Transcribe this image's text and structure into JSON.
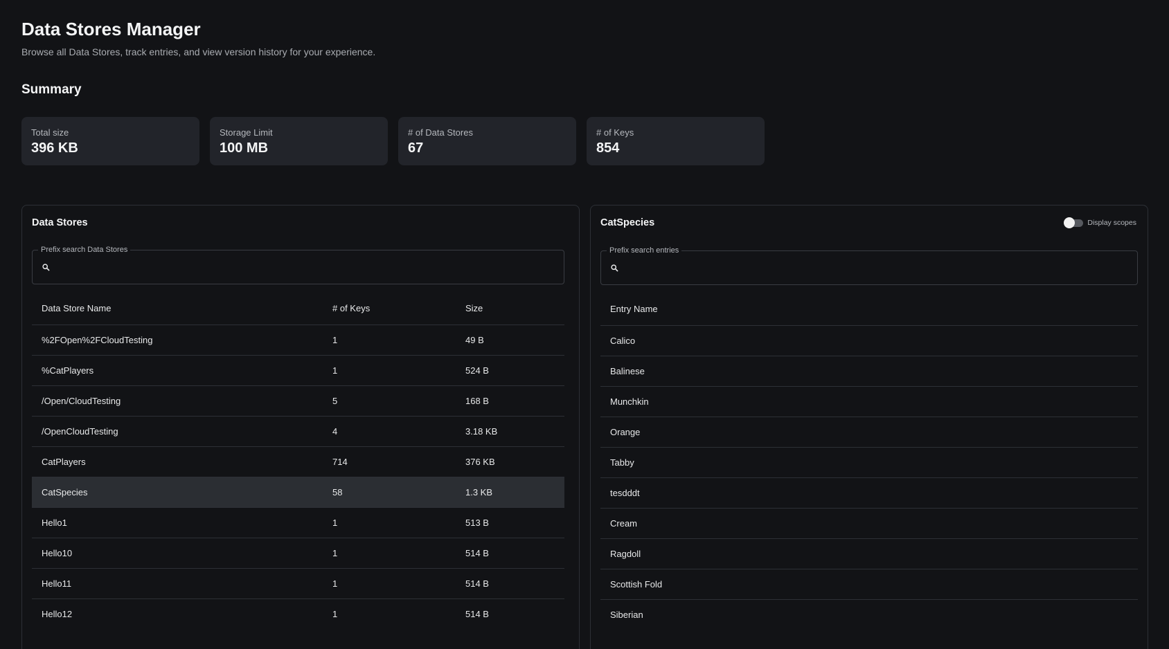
{
  "header": {
    "title": "Data Stores Manager",
    "subtitle": "Browse all Data Stores, track entries, and view version history for your experience."
  },
  "summary": {
    "title": "Summary",
    "cards": [
      {
        "label": "Total size",
        "value": "396 KB"
      },
      {
        "label": "Storage Limit",
        "value": "100 MB"
      },
      {
        "label": "# of Data Stores",
        "value": "67"
      },
      {
        "label": "# of Keys",
        "value": "854"
      }
    ]
  },
  "data_stores": {
    "title": "Data Stores",
    "search": {
      "legend": "Prefix search Data Stores",
      "value": ""
    },
    "columns": {
      "name": "Data Store Name",
      "keys": "# of Keys",
      "size": "Size"
    },
    "rows": [
      {
        "name": "%2FOpen%2FCloudTesting",
        "keys": "1",
        "size": "49 B"
      },
      {
        "name": "%CatPlayers",
        "keys": "1",
        "size": "524 B"
      },
      {
        "name": "/Open/CloudTesting",
        "keys": "5",
        "size": "168 B"
      },
      {
        "name": "/OpenCloudTesting",
        "keys": "4",
        "size": "3.18 KB"
      },
      {
        "name": "CatPlayers",
        "keys": "714",
        "size": "376 KB"
      },
      {
        "name": "CatSpecies",
        "keys": "58",
        "size": "1.3 KB",
        "selected": true
      },
      {
        "name": "Hello1",
        "keys": "1",
        "size": "513 B"
      },
      {
        "name": "Hello10",
        "keys": "1",
        "size": "514 B"
      },
      {
        "name": "Hello11",
        "keys": "1",
        "size": "514 B"
      },
      {
        "name": "Hello12",
        "keys": "1",
        "size": "514 B"
      }
    ]
  },
  "entries": {
    "title": "CatSpecies",
    "toggle": {
      "label": "Display scopes",
      "on": false
    },
    "search": {
      "legend": "Prefix search entries",
      "value": ""
    },
    "columns": {
      "name": "Entry Name"
    },
    "rows": [
      "Calico",
      "Balinese",
      "Munchkin",
      "Orange",
      "Tabby",
      "tesdddt",
      "Cream",
      "Ragdoll",
      "Scottish Fold",
      "Siberian"
    ]
  }
}
